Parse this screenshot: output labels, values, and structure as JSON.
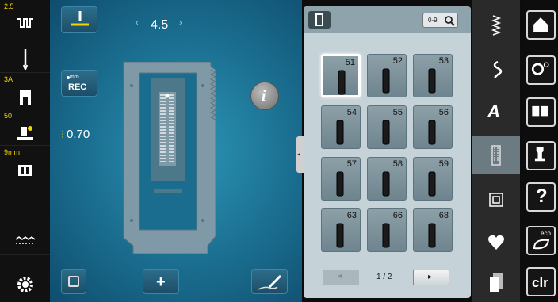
{
  "left_bar": {
    "items": [
      {
        "tag": "2.5",
        "icon": "stitch-width-icon"
      },
      {
        "tag": "",
        "icon": "needle-icon"
      },
      {
        "tag": "3A",
        "icon": "presser-foot-icon"
      },
      {
        "tag": "50",
        "icon": "foot-pressure-icon"
      },
      {
        "tag": "9mm",
        "icon": "stitch-plate-icon"
      },
      {
        "tag": "",
        "icon": "thread-tension-icon"
      },
      {
        "tag": "",
        "icon": "settings-gear-icon"
      }
    ]
  },
  "main": {
    "width_value": "4.5",
    "width_left_arrow": "‹",
    "width_right_arrow": "›",
    "rec_label": "REC",
    "rec_unit": "mm",
    "length_value": "0.70",
    "info_label": "i",
    "plus_label": "+"
  },
  "stitch_list": {
    "search_label": "0-9",
    "cells": [
      {
        "num": "51",
        "selected": true
      },
      {
        "num": "52",
        "selected": false
      },
      {
        "num": "53",
        "selected": false
      },
      {
        "num": "54",
        "selected": false
      },
      {
        "num": "55",
        "selected": false
      },
      {
        "num": "56",
        "selected": false
      },
      {
        "num": "57",
        "selected": false
      },
      {
        "num": "58",
        "selected": false
      },
      {
        "num": "59",
        "selected": false
      },
      {
        "num": "63",
        "selected": false
      },
      {
        "num": "66",
        "selected": false
      },
      {
        "num": "68",
        "selected": false
      }
    ],
    "pager": {
      "prev": "◂",
      "page": "1 / 2",
      "next": "▸"
    }
  },
  "categories": [
    {
      "icon": "practical-stitch-icon",
      "label": ""
    },
    {
      "icon": "decorative-stitch-icon",
      "label": ""
    },
    {
      "icon": "alphabet-icon",
      "label": "A"
    },
    {
      "icon": "buttonhole-icon",
      "label": "",
      "active": true
    },
    {
      "icon": "quilt-stitch-icon",
      "label": ""
    },
    {
      "icon": "favorite-heart-icon",
      "label": ""
    },
    {
      "icon": "memory-icon",
      "label": ""
    }
  ],
  "right_buttons": [
    {
      "icon": "home-icon",
      "label": ""
    },
    {
      "icon": "setup-icon",
      "label": ""
    },
    {
      "icon": "tutorial-book-icon",
      "label": ""
    },
    {
      "icon": "sewing-consultant-icon",
      "label": ""
    },
    {
      "icon": "help-icon",
      "label": "?"
    },
    {
      "icon": "eco-icon",
      "label": "eco"
    },
    {
      "icon": "clear-icon",
      "label": "clr"
    }
  ],
  "colors": {
    "accent_yellow": "#f1d400",
    "main_blue": "#1a6d8f",
    "panel_gray": "#c5d2d8"
  }
}
